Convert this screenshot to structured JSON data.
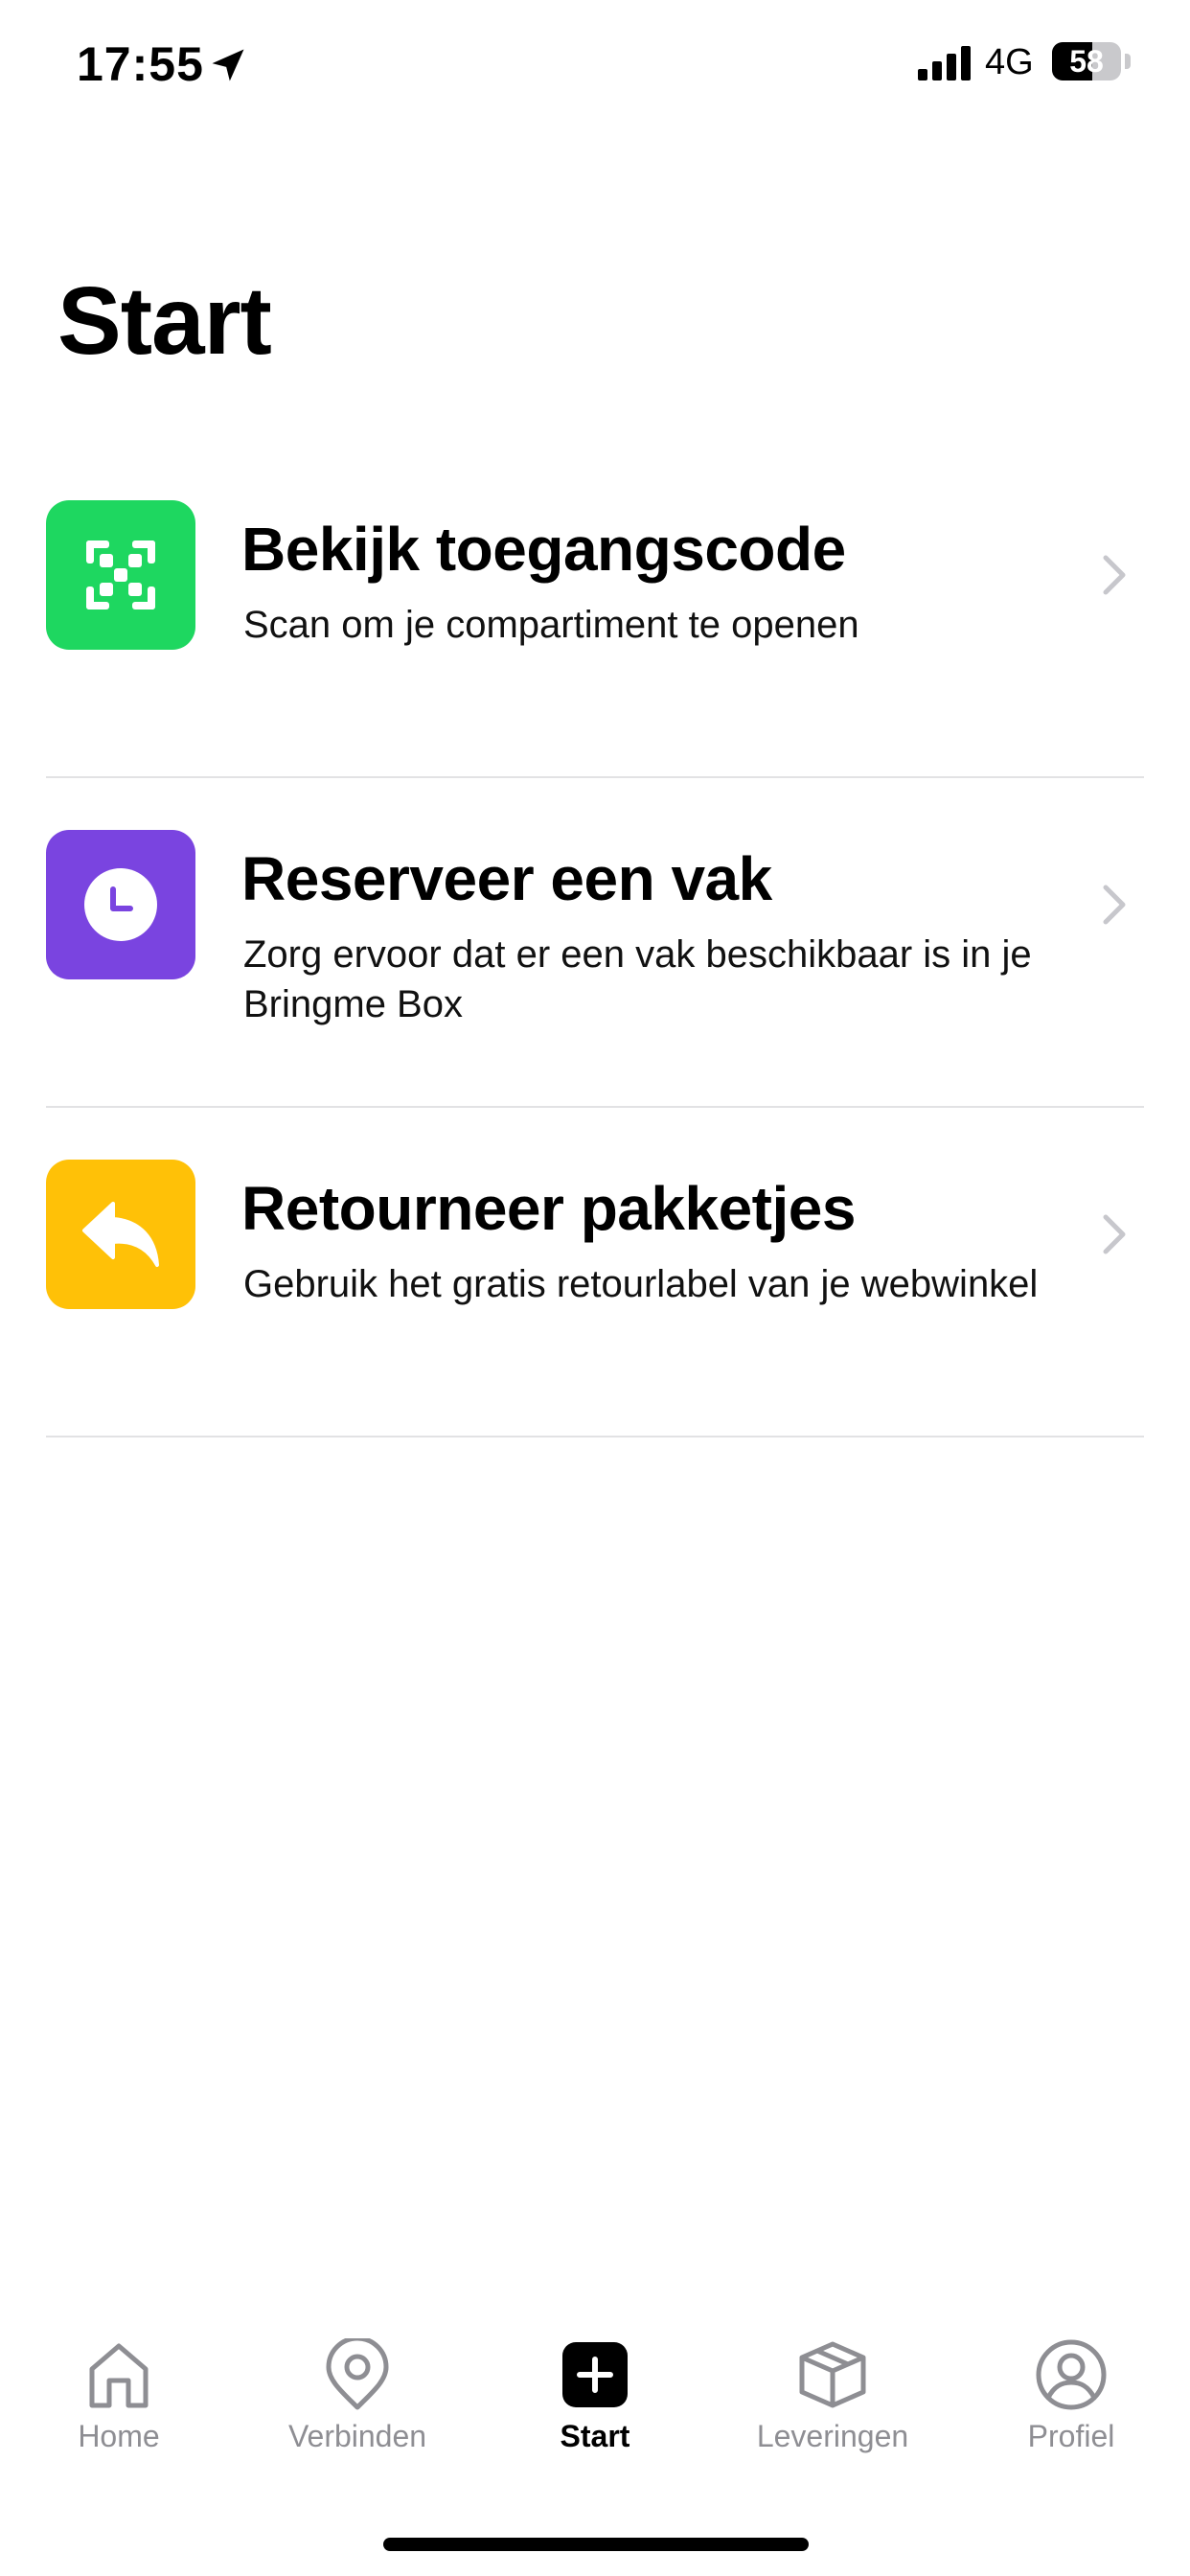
{
  "status_bar": {
    "time": "17:55",
    "network": "4G",
    "battery_level": "58",
    "location_icon": "location-arrow-icon",
    "signal_icon": "cellular-signal-icon"
  },
  "page": {
    "title": "Start"
  },
  "actions": [
    {
      "title": "Bekijk toegangscode",
      "subtitle": "Scan om je compartiment te openen",
      "icon": "qr-code-icon",
      "color": "#1ed760"
    },
    {
      "title": "Reserveer een vak",
      "subtitle": "Zorg ervoor dat er een vak beschikbaar is in je Bringme Box",
      "icon": "clock-icon",
      "color": "#7a44e0"
    },
    {
      "title": "Retourneer pakketjes",
      "subtitle": "Gebruik het gratis retourlabel van je webwinkel",
      "icon": "reply-arrow-icon",
      "color": "#ffc107"
    }
  ],
  "tab_bar": {
    "items": [
      {
        "label": "Home",
        "icon": "home-icon"
      },
      {
        "label": "Verbinden",
        "icon": "location-pin-icon"
      },
      {
        "label": "Start",
        "icon": "plus-square-icon",
        "active": true
      },
      {
        "label": "Leveringen",
        "icon": "package-box-icon"
      },
      {
        "label": "Profiel",
        "icon": "user-circle-icon"
      }
    ]
  }
}
